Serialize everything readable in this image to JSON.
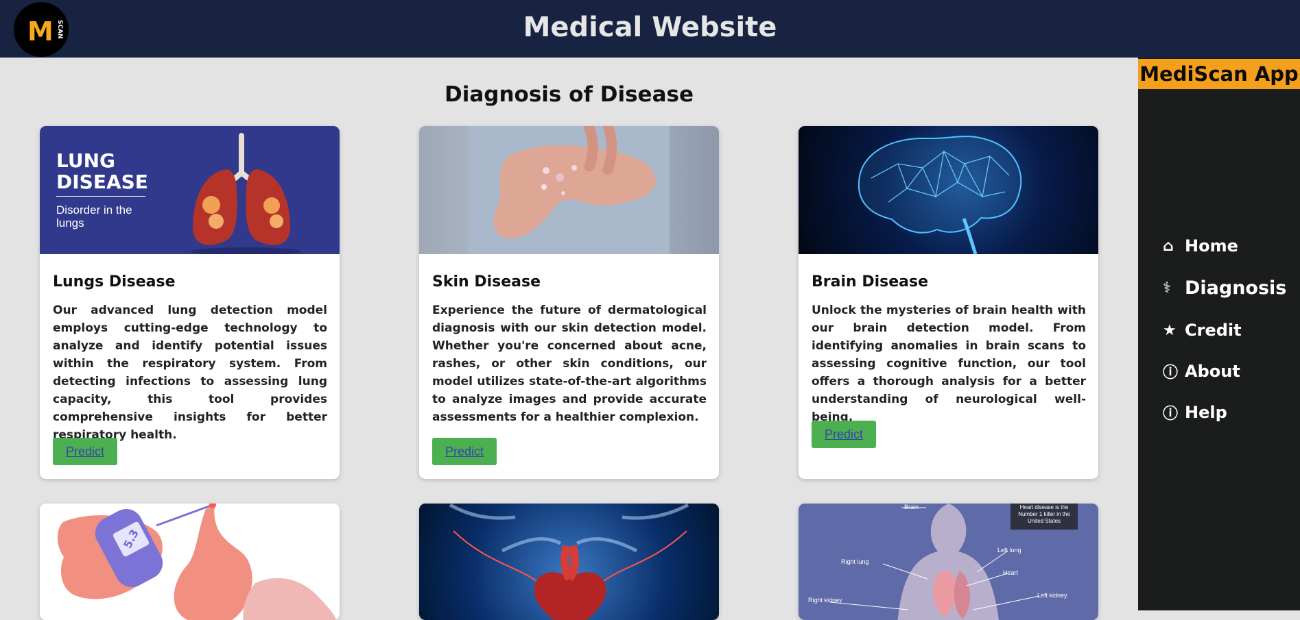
{
  "header": {
    "title": "Medical Website",
    "logo_letter": "M",
    "logo_side": "SCAN"
  },
  "sidebar": {
    "brand": "MediScan App",
    "items": [
      {
        "label": "Home",
        "icon": "⌂",
        "icon_name": "home-icon"
      },
      {
        "label": "Diagnosis",
        "icon": "⚕",
        "icon_name": "stethoscope-icon"
      },
      {
        "label": "Credit",
        "icon": "★",
        "icon_name": "star-icon"
      },
      {
        "label": "About",
        "icon": "ⓘ",
        "icon_name": "info-icon"
      },
      {
        "label": "Help",
        "icon": "ⓘ",
        "icon_name": "info-icon"
      }
    ]
  },
  "main": {
    "heading": "Diagnosis of Disease",
    "cards": [
      {
        "title": "Lungs Disease",
        "text": "Our advanced lung detection model employs cutting-edge technology to analyze and identify potential issues within the respiratory system. From detecting infections to assessing lung capacity, this tool provides comprehensive insights for better respiratory health.",
        "button": "Predict",
        "image_title": "LUNG DISEASE",
        "image_subtitle": "Disorder in the lungs"
      },
      {
        "title": "Skin Disease",
        "text": "Experience the future of dermatological diagnosis with our skin detection model. Whether you're concerned about acne, rashes, or other skin conditions, our model utilizes state-of-the-art algorithms to analyze images and provide accurate assessments for a healthier complexion.",
        "button": "Predict"
      },
      {
        "title": "Brain Disease",
        "text": "Unlock the mysteries of brain health with our brain detection model. From identifying anomalies in brain scans to assessing cognitive function, our tool offers a thorough analysis for a better understanding of neurological well-being.",
        "button": "Predict"
      }
    ],
    "lower_cards": [
      {
        "image_text": "5.3"
      },
      {},
      {
        "labels": [
          "Brain",
          "Heart disease is the Number 1 killer in the United States",
          "Left lung",
          "Right lung",
          "Heart",
          "Right kidney",
          "Left kidney"
        ]
      }
    ]
  },
  "colors": {
    "header": "#172341",
    "sidebar": "#1a1d1b",
    "brand": "#f5a01c",
    "button": "#4caf50"
  }
}
